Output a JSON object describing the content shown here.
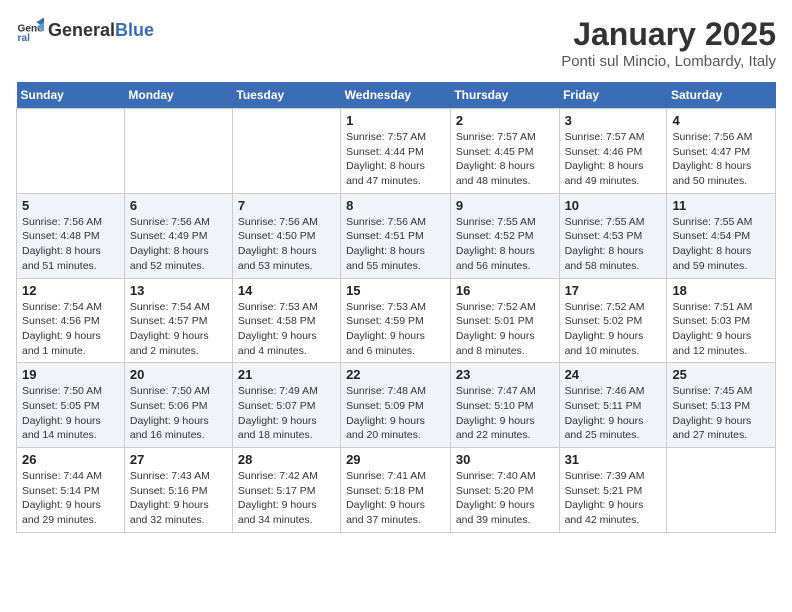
{
  "logo": {
    "general": "General",
    "blue": "Blue"
  },
  "title": "January 2025",
  "subtitle": "Ponti sul Mincio, Lombardy, Italy",
  "weekdays": [
    "Sunday",
    "Monday",
    "Tuesday",
    "Wednesday",
    "Thursday",
    "Friday",
    "Saturday"
  ],
  "weeks": [
    [
      {
        "day": "",
        "info": ""
      },
      {
        "day": "",
        "info": ""
      },
      {
        "day": "",
        "info": ""
      },
      {
        "day": "1",
        "info": "Sunrise: 7:57 AM\nSunset: 4:44 PM\nDaylight: 8 hours and 47 minutes."
      },
      {
        "day": "2",
        "info": "Sunrise: 7:57 AM\nSunset: 4:45 PM\nDaylight: 8 hours and 48 minutes."
      },
      {
        "day": "3",
        "info": "Sunrise: 7:57 AM\nSunset: 4:46 PM\nDaylight: 8 hours and 49 minutes."
      },
      {
        "day": "4",
        "info": "Sunrise: 7:56 AM\nSunset: 4:47 PM\nDaylight: 8 hours and 50 minutes."
      }
    ],
    [
      {
        "day": "5",
        "info": "Sunrise: 7:56 AM\nSunset: 4:48 PM\nDaylight: 8 hours and 51 minutes."
      },
      {
        "day": "6",
        "info": "Sunrise: 7:56 AM\nSunset: 4:49 PM\nDaylight: 8 hours and 52 minutes."
      },
      {
        "day": "7",
        "info": "Sunrise: 7:56 AM\nSunset: 4:50 PM\nDaylight: 8 hours and 53 minutes."
      },
      {
        "day": "8",
        "info": "Sunrise: 7:56 AM\nSunset: 4:51 PM\nDaylight: 8 hours and 55 minutes."
      },
      {
        "day": "9",
        "info": "Sunrise: 7:55 AM\nSunset: 4:52 PM\nDaylight: 8 hours and 56 minutes."
      },
      {
        "day": "10",
        "info": "Sunrise: 7:55 AM\nSunset: 4:53 PM\nDaylight: 8 hours and 58 minutes."
      },
      {
        "day": "11",
        "info": "Sunrise: 7:55 AM\nSunset: 4:54 PM\nDaylight: 8 hours and 59 minutes."
      }
    ],
    [
      {
        "day": "12",
        "info": "Sunrise: 7:54 AM\nSunset: 4:56 PM\nDaylight: 9 hours and 1 minute."
      },
      {
        "day": "13",
        "info": "Sunrise: 7:54 AM\nSunset: 4:57 PM\nDaylight: 9 hours and 2 minutes."
      },
      {
        "day": "14",
        "info": "Sunrise: 7:53 AM\nSunset: 4:58 PM\nDaylight: 9 hours and 4 minutes."
      },
      {
        "day": "15",
        "info": "Sunrise: 7:53 AM\nSunset: 4:59 PM\nDaylight: 9 hours and 6 minutes."
      },
      {
        "day": "16",
        "info": "Sunrise: 7:52 AM\nSunset: 5:01 PM\nDaylight: 9 hours and 8 minutes."
      },
      {
        "day": "17",
        "info": "Sunrise: 7:52 AM\nSunset: 5:02 PM\nDaylight: 9 hours and 10 minutes."
      },
      {
        "day": "18",
        "info": "Sunrise: 7:51 AM\nSunset: 5:03 PM\nDaylight: 9 hours and 12 minutes."
      }
    ],
    [
      {
        "day": "19",
        "info": "Sunrise: 7:50 AM\nSunset: 5:05 PM\nDaylight: 9 hours and 14 minutes."
      },
      {
        "day": "20",
        "info": "Sunrise: 7:50 AM\nSunset: 5:06 PM\nDaylight: 9 hours and 16 minutes."
      },
      {
        "day": "21",
        "info": "Sunrise: 7:49 AM\nSunset: 5:07 PM\nDaylight: 9 hours and 18 minutes."
      },
      {
        "day": "22",
        "info": "Sunrise: 7:48 AM\nSunset: 5:09 PM\nDaylight: 9 hours and 20 minutes."
      },
      {
        "day": "23",
        "info": "Sunrise: 7:47 AM\nSunset: 5:10 PM\nDaylight: 9 hours and 22 minutes."
      },
      {
        "day": "24",
        "info": "Sunrise: 7:46 AM\nSunset: 5:11 PM\nDaylight: 9 hours and 25 minutes."
      },
      {
        "day": "25",
        "info": "Sunrise: 7:45 AM\nSunset: 5:13 PM\nDaylight: 9 hours and 27 minutes."
      }
    ],
    [
      {
        "day": "26",
        "info": "Sunrise: 7:44 AM\nSunset: 5:14 PM\nDaylight: 9 hours and 29 minutes."
      },
      {
        "day": "27",
        "info": "Sunrise: 7:43 AM\nSunset: 5:16 PM\nDaylight: 9 hours and 32 minutes."
      },
      {
        "day": "28",
        "info": "Sunrise: 7:42 AM\nSunset: 5:17 PM\nDaylight: 9 hours and 34 minutes."
      },
      {
        "day": "29",
        "info": "Sunrise: 7:41 AM\nSunset: 5:18 PM\nDaylight: 9 hours and 37 minutes."
      },
      {
        "day": "30",
        "info": "Sunrise: 7:40 AM\nSunset: 5:20 PM\nDaylight: 9 hours and 39 minutes."
      },
      {
        "day": "31",
        "info": "Sunrise: 7:39 AM\nSunset: 5:21 PM\nDaylight: 9 hours and 42 minutes."
      },
      {
        "day": "",
        "info": ""
      }
    ]
  ]
}
